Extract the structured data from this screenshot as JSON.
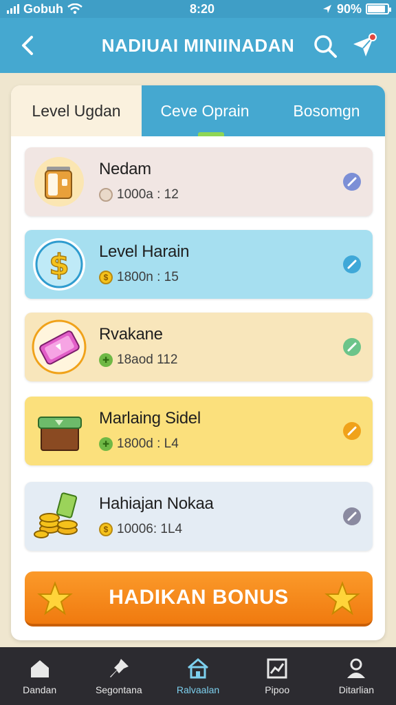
{
  "status_bar": {
    "carrier": "Gobuh",
    "time": "8:20",
    "battery": "90%",
    "battery_level": 0.9
  },
  "header": {
    "title": "NADIUAI MINIINADAN",
    "back_icon": "chevron-left-icon",
    "search_icon": "search-icon",
    "send_icon": "paper-plane-icon"
  },
  "tabs": [
    {
      "label": "Level Ugdan",
      "active": true
    },
    {
      "label": "Ceve Oprain",
      "active": false
    },
    {
      "label": "Bosomgn",
      "active": false
    }
  ],
  "items": [
    {
      "name": "Nedam",
      "meta": "1000a : 12",
      "icon": "jar-icon",
      "bg": "#f1e6e3",
      "action_color": "#7c8fd6",
      "coin": "clock"
    },
    {
      "name": "Level Harain",
      "meta": "1800n : 15",
      "icon": "dollar-icon",
      "bg": "#a6dff0",
      "action_color": "#3fa8d8",
      "coin": "gold"
    },
    {
      "name": "Rvakane",
      "meta": "18aod 112",
      "icon": "ticket-icon",
      "bg": "#f8e6bb",
      "action_color": "#6cc48a",
      "coin": "green"
    },
    {
      "name": "Marlaing Sidel",
      "meta": "1800d : L4",
      "icon": "chest-icon",
      "bg": "#fbe07c",
      "action_color": "#f0a21a",
      "coin": "green"
    },
    {
      "name": "Hahiajan Nokaa",
      "meta": "10006: 1L4",
      "icon": "coins-icon",
      "bg": "#e4ecf4",
      "action_color": "#8a8aa0",
      "coin": "gold"
    }
  ],
  "bonus": {
    "label": "HADIKAN BONUS"
  },
  "bottom_nav": [
    {
      "label": "Dandan",
      "icon": "home-icon",
      "active": false
    },
    {
      "label": "Segontana",
      "icon": "pin-icon",
      "active": false
    },
    {
      "label": "Ralvaalan",
      "icon": "house-icon",
      "active": true
    },
    {
      "label": "Pipoo",
      "icon": "chart-icon",
      "active": false
    },
    {
      "label": "Ditarlian",
      "icon": "user-icon",
      "active": false
    }
  ]
}
